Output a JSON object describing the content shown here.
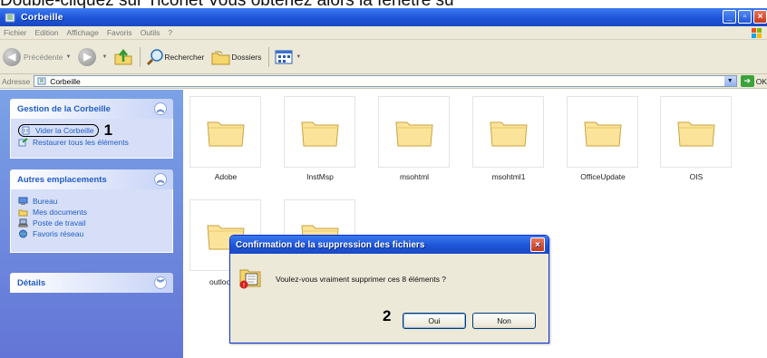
{
  "caption": "Double-cliquez sur Ticonet Vous obtenez alors la fenêtre su",
  "window": {
    "title": "Corbeille"
  },
  "menu": [
    "Fichier",
    "Edition",
    "Affichage",
    "Favoris",
    "Outils",
    "?"
  ],
  "toolbar": {
    "back_label": "Précédente",
    "search_label": "Rechercher",
    "folders_label": "Dossiers"
  },
  "address": {
    "label": "Adresse",
    "value": "Corbeille",
    "go_label": "OK"
  },
  "sidebar": {
    "tasks": {
      "title": "Gestion de la Corbeille",
      "items": [
        "Vider la Corbeille",
        "Restaurer tous les éléments"
      ],
      "step": "1"
    },
    "places": {
      "title": "Autres emplacements",
      "items": [
        "Bureau",
        "Mes documents",
        "Poste de travail",
        "Favoris réseau"
      ]
    },
    "details": {
      "title": "Détails"
    }
  },
  "folders": [
    "Adobe",
    "InstMsp",
    "msohtml",
    "msohtml1",
    "OfficeUpdate",
    "OIS",
    "outlook lc",
    ""
  ],
  "dialog": {
    "title": "Confirmation de la suppression des fichiers",
    "message": "Voulez-vous vraiment supprimer ces 8 éléments ?",
    "step": "2",
    "ok_label": "Oui",
    "cancel_label": "Non"
  },
  "colors": {
    "titlebar": "#1c54d8",
    "taskpane": "#7ba2e7",
    "link": "#215dc6",
    "dialog_bg": "#ece9d8"
  }
}
